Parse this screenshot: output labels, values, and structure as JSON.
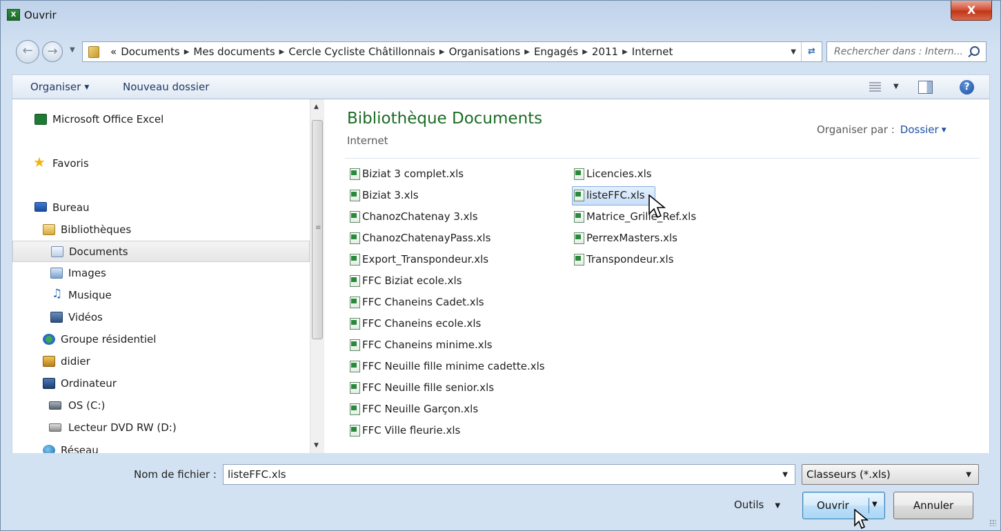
{
  "window": {
    "title": "Ouvrir",
    "close_label": "X",
    "app_icon_label": "X"
  },
  "address": {
    "path": [
      "«",
      "Documents",
      "Mes documents",
      "Cercle Cycliste Châtillonnais",
      "Organisations",
      "Engagés",
      "2011",
      "Internet"
    ]
  },
  "search": {
    "placeholder": "Rechercher dans : Intern..."
  },
  "toolbar": {
    "organise_label": "Organiser",
    "new_folder_label": "Nouveau dossier",
    "help_label": "?"
  },
  "nav": {
    "items": [
      {
        "label": "Microsoft Office Excel",
        "icon": "excel-icon"
      },
      {
        "label": "Favoris",
        "icon": "star-icon"
      },
      {
        "label": "Bureau",
        "icon": "desktop-icon"
      },
      {
        "label": "Bibliothèques",
        "icon": "libraries-icon"
      },
      {
        "label": "Documents",
        "icon": "documents-icon",
        "selected": true
      },
      {
        "label": "Images",
        "icon": "pictures-icon"
      },
      {
        "label": "Musique",
        "icon": "music-icon"
      },
      {
        "label": "Vidéos",
        "icon": "videos-icon"
      },
      {
        "label": "Groupe résidentiel",
        "icon": "homegroup-icon"
      },
      {
        "label": "didier",
        "icon": "user-folder-icon"
      },
      {
        "label": "Ordinateur",
        "icon": "computer-icon"
      },
      {
        "label": "OS (C:)",
        "icon": "drive-icon"
      },
      {
        "label": "Lecteur DVD RW (D:)",
        "icon": "dvd-drive-icon"
      },
      {
        "label": "Réseau",
        "icon": "network-icon"
      }
    ]
  },
  "content": {
    "title": "Bibliothèque Documents",
    "subtitle": "Internet",
    "arrange_label": "Organiser par :",
    "arrange_value": "Dossier",
    "files_col1": [
      "Biziat 3 complet.xls",
      "Biziat 3.xls",
      "ChanozChatenay 3.xls",
      "ChanozChatenayPass.xls",
      "Export_Transpondeur.xls",
      "FFC Biziat ecole.xls",
      "FFC Chaneins Cadet.xls",
      "FFC Chaneins ecole.xls",
      "FFC Chaneins minime.xls",
      "FFC Neuille fille minime cadette.xls",
      "FFC Neuille fille senior.xls",
      "FFC Neuille Garçon.xls",
      "FFC Ville fleurie.xls"
    ],
    "files_col2": [
      "Licencies.xls",
      "listeFFC.xls",
      "Matrice_Grille_Ref.xls",
      "PerrexMasters.xls",
      "Transpondeur.xls"
    ],
    "selected_file": "listeFFC.xls"
  },
  "footer": {
    "filename_label": "Nom de fichier :",
    "filename_value": "listeFFC.xls",
    "filter_value": "Classeurs (*.xls)",
    "tools_label": "Outils",
    "open_label": "Ouvrir",
    "cancel_label": "Annuler"
  }
}
